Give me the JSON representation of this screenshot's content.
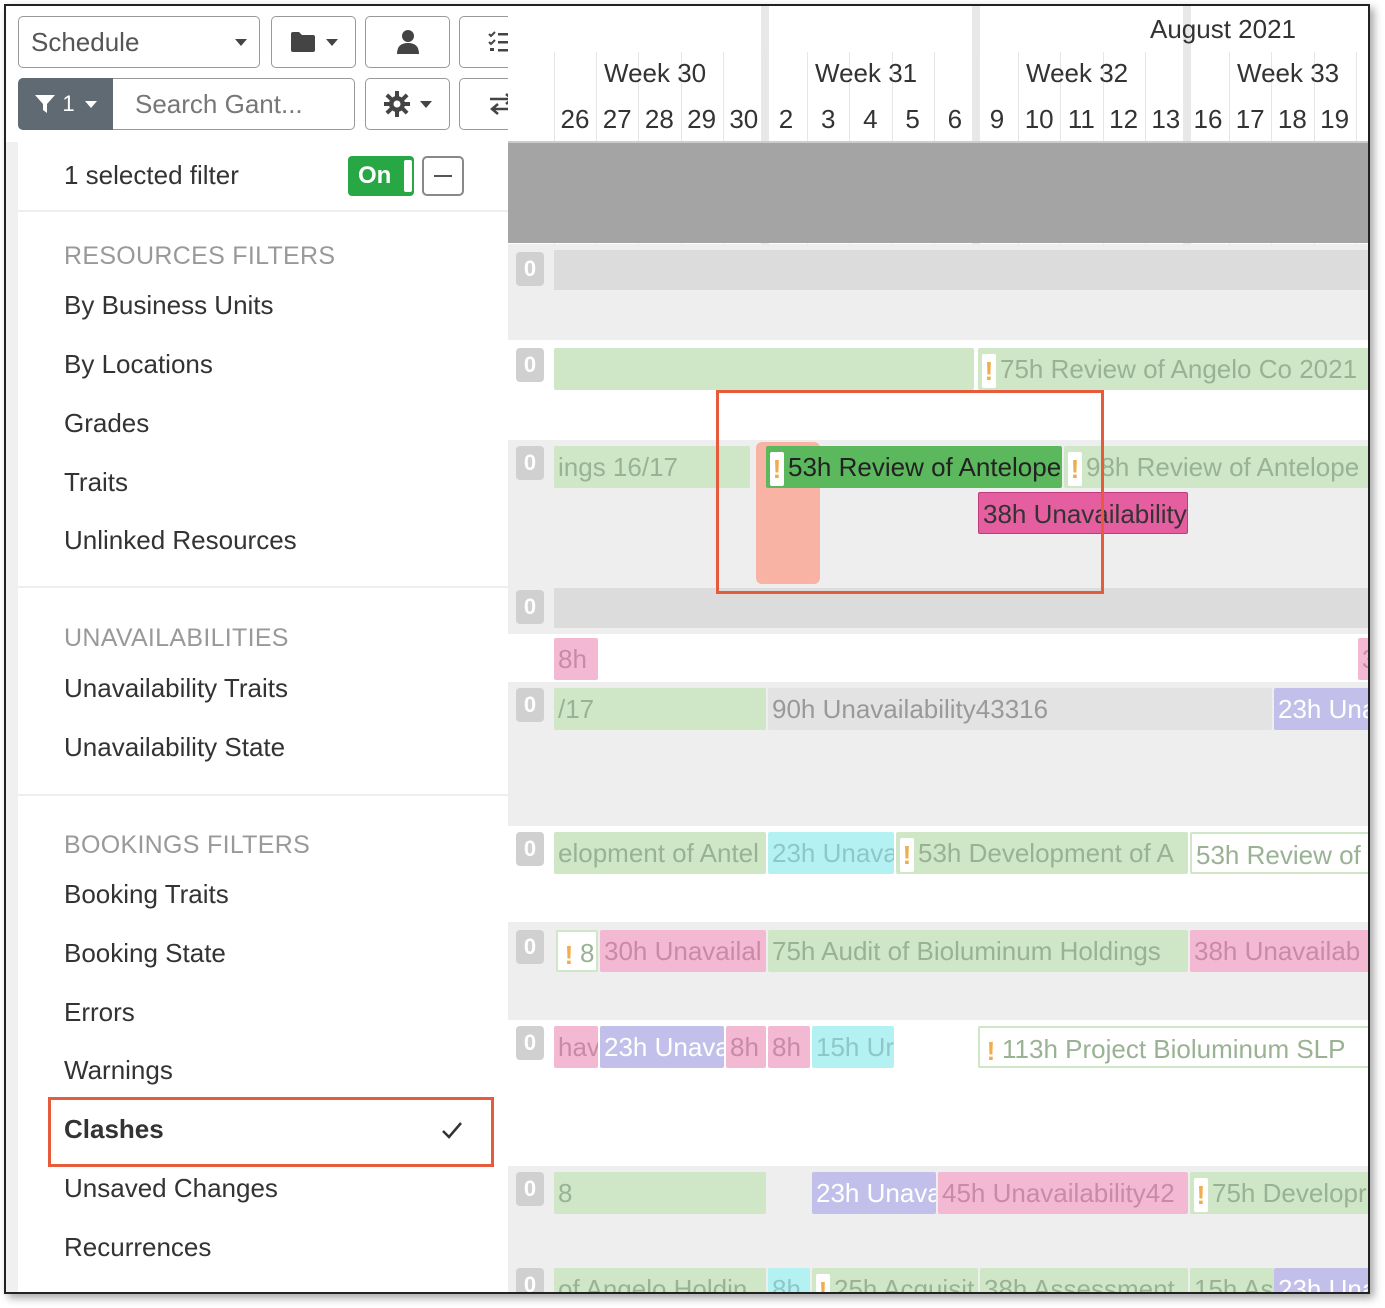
{
  "toolbar": {
    "schedule_label": "Schedule",
    "filter_count": "1",
    "search_placeholder": "Search Gant..."
  },
  "filter_panel": {
    "selected_text": "1 selected filter",
    "toggle_label": "On",
    "sections": [
      {
        "header": "RESOURCES FILTERS",
        "items": [
          "By Business Units",
          "By Locations",
          "Grades",
          "Traits",
          "Unlinked Resources"
        ]
      },
      {
        "header": "UNAVAILABILITIES",
        "items": [
          "Unavailability Traits",
          "Unavailability State"
        ]
      },
      {
        "header": "BOOKINGS FILTERS",
        "items": [
          "Booking Traits",
          "Booking State",
          "Errors",
          "Warnings",
          "Clashes",
          "Unsaved Changes",
          "Recurrences"
        ]
      }
    ],
    "active_item": "Clashes"
  },
  "gantt": {
    "month": "August 2021",
    "weeks": [
      "Week 30",
      "Week 31",
      "Week 32",
      "Week 33"
    ],
    "days": [
      "26",
      "27",
      "28",
      "29",
      "30",
      "2",
      "3",
      "4",
      "5",
      "6",
      "9",
      "10",
      "11",
      "12",
      "13",
      "16",
      "17",
      "18",
      "19",
      "2"
    ],
    "row_counts": [
      "0",
      "0",
      "0",
      "0",
      "0",
      "0",
      "0",
      "0",
      "0",
      "0",
      "0"
    ],
    "bars": {
      "r2_a": "75h Review of Angelo Co 2021",
      "r3_a": "ings 16/17",
      "r3_b": "53h Review of Antelope",
      "r3_c": "98h Review of Antelope",
      "r3_d": "38h Unavailability",
      "r4_a": "8h",
      "r4_b": "3",
      "r5_a": "/17",
      "r5_b": "90h Unavailability43316",
      "r5_c": "23h Una",
      "r6_a": "elopment of Antel",
      "r6_b": "23h Unava",
      "r6_c": "53h Development of A",
      "r6_d": "53h Review of",
      "r7_a": "8l",
      "r7_b": "30h Unavailal",
      "r7_c": "75h Audit of Bioluminum Holdings",
      "r7_d": "38h Unavailab",
      "r8_a": "hava",
      "r8_b": "23h Unava",
      "r8_c": "8h",
      "r8_d": "8h",
      "r8_e": "15h Ur",
      "r8_f": "113h Project Bioluminum SLP",
      "r9_a": "8",
      "r9_b": "23h Unava",
      "r9_c": "45h Unavailability42",
      "r9_d": "75h Developr",
      "r10_a": "of Angelo Holdin",
      "r10_b": "8h",
      "r10_c": "25h Acquisit",
      "r10_d": "38h Assessment",
      "r10_e": "15h As",
      "r10_f": "23h Una"
    }
  }
}
